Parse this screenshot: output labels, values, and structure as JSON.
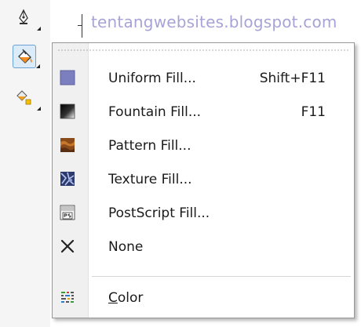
{
  "watermark": "tentangwebsites.blogspot.com",
  "toolbox": {
    "tools": [
      {
        "icon": "pen-nib-icon"
      },
      {
        "icon": "paint-bucket-icon",
        "active": true
      },
      {
        "icon": "interactive-fill-icon"
      }
    ]
  },
  "menu": {
    "items": [
      {
        "label": "Uniform Fill...",
        "shortcut": "Shift+F11",
        "icon": "uniform-fill-icon"
      },
      {
        "label": "Fountain Fill...",
        "shortcut": "F11",
        "icon": "fountain-fill-icon"
      },
      {
        "label": "Pattern Fill...",
        "shortcut": "",
        "icon": "pattern-fill-icon"
      },
      {
        "label": "Texture Fill...",
        "shortcut": "",
        "icon": "texture-fill-icon"
      },
      {
        "label": "PostScript Fill...",
        "shortcut": "",
        "icon": "postscript-fill-icon"
      },
      {
        "label": "None",
        "shortcut": "",
        "icon": "close-icon"
      }
    ],
    "color_item": {
      "mnemonic": "C",
      "rest": "olor",
      "icon": "color-palette-icon"
    }
  },
  "colors": {
    "uniform": "#7b7fbf",
    "menu_border": "#979797",
    "active_tool": "#dcebf8"
  }
}
